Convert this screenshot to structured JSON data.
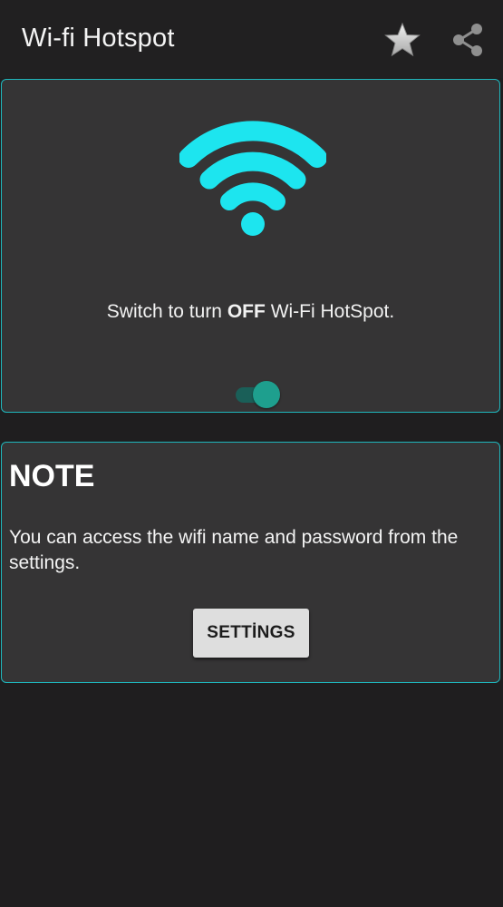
{
  "toolbar": {
    "title": "Wi-fi Hotspot",
    "actions": [
      {
        "icon": "star-icon"
      },
      {
        "icon": "share-icon"
      }
    ]
  },
  "hotspot": {
    "icon": "wifi-icon",
    "status_prefix": "Switch to turn",
    "status_state": "OFF",
    "status_suffix": "Wi-Fi HotSpot.",
    "toggle_on": true
  },
  "note": {
    "title": "NOTE",
    "text": "You can access the wifi name and password from the settings.",
    "settings_label": "SETTİNGS"
  },
  "colors": {
    "accent": "#1fb7bd",
    "wifi": "#1de5ef",
    "toggle_thumb": "#1e9f8e",
    "toggle_track": "#1a5f58",
    "card_bg": "#353435",
    "app_bg": "#1f1e1f"
  }
}
